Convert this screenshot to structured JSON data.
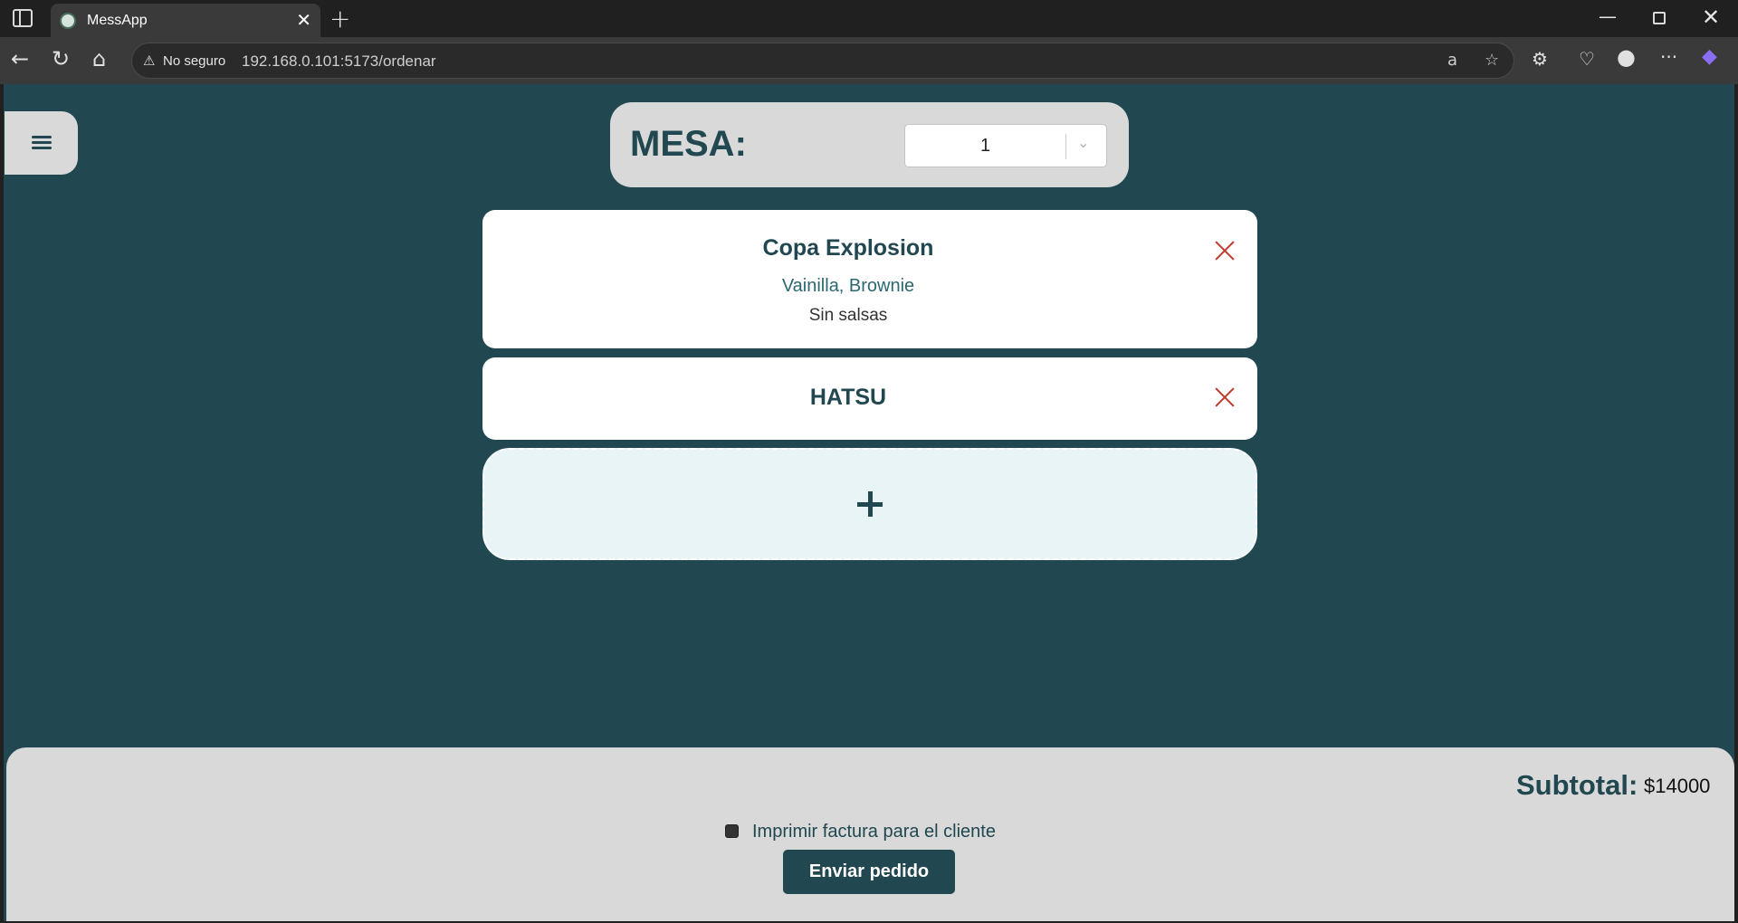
{
  "browser": {
    "tab_title": "MessApp",
    "security_label": "No seguro",
    "url": "192.168.0.101:5173/ordenar"
  },
  "mesa": {
    "label": "MESA:",
    "selected": "1"
  },
  "order_items": [
    {
      "name": "Copa Explosion",
      "flavors": "Vainilla, Brownie",
      "note": "Sin salsas"
    },
    {
      "name": "HATSU"
    }
  ],
  "add_item_label": "+",
  "footer": {
    "subtotal_label": "Subtotal:",
    "subtotal_value": "$14000",
    "print_invoice_label": "Imprimir factura para el cliente",
    "print_invoice_checked": false,
    "send_label": "Enviar pedido"
  },
  "colors": {
    "page_background": "#214750",
    "panel_background": "#d9d9d9",
    "accent": "#214750",
    "remove": "#c0392b"
  },
  "icons": [
    "menu-icon",
    "close-icon",
    "plus-icon",
    "chevron-down-icon"
  ]
}
